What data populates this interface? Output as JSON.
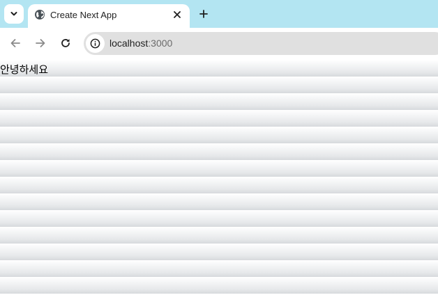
{
  "browser": {
    "tab": {
      "title": "Create Next App",
      "favicon_icon": "globe-icon",
      "close_icon": "close-icon"
    },
    "tab_search_icon": "chevron-down-icon",
    "new_tab_icon": "plus-icon",
    "toolbar": {
      "back_icon": "arrow-left-icon",
      "forward_icon": "arrow-right-icon",
      "reload_icon": "reload-icon",
      "site_info_icon": "info-icon"
    },
    "address": {
      "host": "localhost",
      "port": ":3000"
    },
    "colors": {
      "tabstrip": "#b3e5f2",
      "omnibox": "#e0e0e0"
    }
  },
  "page": {
    "text": "안녕하세요"
  }
}
